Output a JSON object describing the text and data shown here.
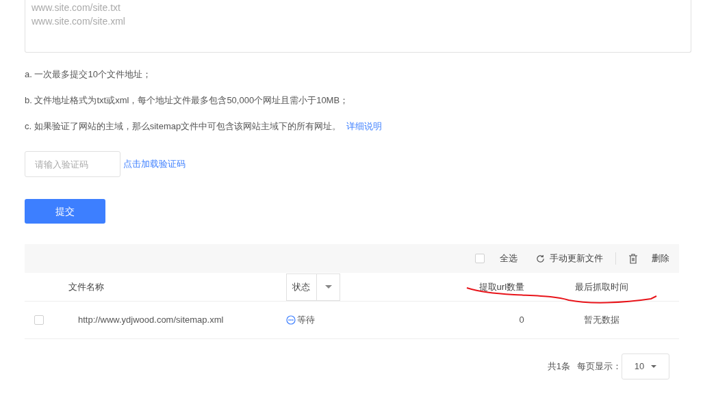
{
  "sitemap_field": {
    "placeholder_lines": [
      "www.site.com/site.txt",
      "www.site.com/site.xml"
    ]
  },
  "notes": [
    "a. 一次最多提交10个文件地址；",
    "b. 文件地址格式为txt或xml，每个地址文件最多包含50,000个网址且需小于10MB；",
    "c. 如果验证了网站的主域，那么sitemap文件中可包含该网站主域下的所有网址。"
  ],
  "details_link": "详细说明",
  "captcha": {
    "placeholder": "请输入验证码",
    "load_link": "点击加载验证码"
  },
  "submit_button": "提交",
  "toolbar": {
    "select_all": {
      "label": "全选",
      "checked": false
    },
    "refresh": "手动更新文件",
    "delete": "删除"
  },
  "table": {
    "columns": [
      {
        "label": "文件名称",
        "kind": "text"
      },
      {
        "label": "状态",
        "kind": "filter"
      },
      {
        "label": "提取url数量",
        "kind": "text"
      },
      {
        "label": "最后抓取时间",
        "kind": "text"
      }
    ],
    "rows": [
      {
        "checked": false,
        "file": "http://www.ydjwood.com/sitemap.xml",
        "status": "等待",
        "url_count": "0",
        "last_crawl": "暂无数据"
      }
    ]
  },
  "pagination": {
    "total": "共1条",
    "per_page_label": "每页显示：",
    "per_page": "10"
  }
}
